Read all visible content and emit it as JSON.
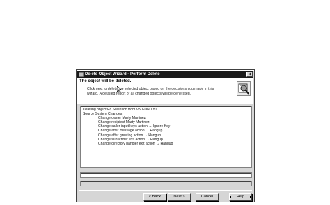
{
  "window": {
    "title": "Delete Object Wizard - Perform Delete",
    "close_glyph": "×"
  },
  "header": {
    "heading": "The object will be deleted.",
    "description": "Click next to delete the selected object based on the decisions you made in this wizard. A detailed report of all changed objects will be generated.",
    "icon": "wizard-delete-icon"
  },
  "log": {
    "lines": [
      {
        "text": "Deleting object Ed Swenson from VNT-UNITY1",
        "indent": false
      },
      {
        "text": "Source System Changes",
        "indent": false
      },
      {
        "text": "Change owner  Marty Martinez",
        "indent": true
      },
      {
        "text": "Change recipient  Marty Martinez",
        "indent": true
      },
      {
        "text": "Change caller input keys action → Ignore Key",
        "indent": true
      },
      {
        "text": "Change after message action → Hangup",
        "indent": true
      },
      {
        "text": "Change after greeting action → Hangup",
        "indent": true
      },
      {
        "text": "Change subscriber exit action → Hangup",
        "indent": true
      },
      {
        "text": "Change directory handler exit action → Hangup",
        "indent": true
      }
    ]
  },
  "buttons": {
    "back": "< Back",
    "next": "Next >",
    "cancel": "Cancel",
    "help": "Help"
  }
}
